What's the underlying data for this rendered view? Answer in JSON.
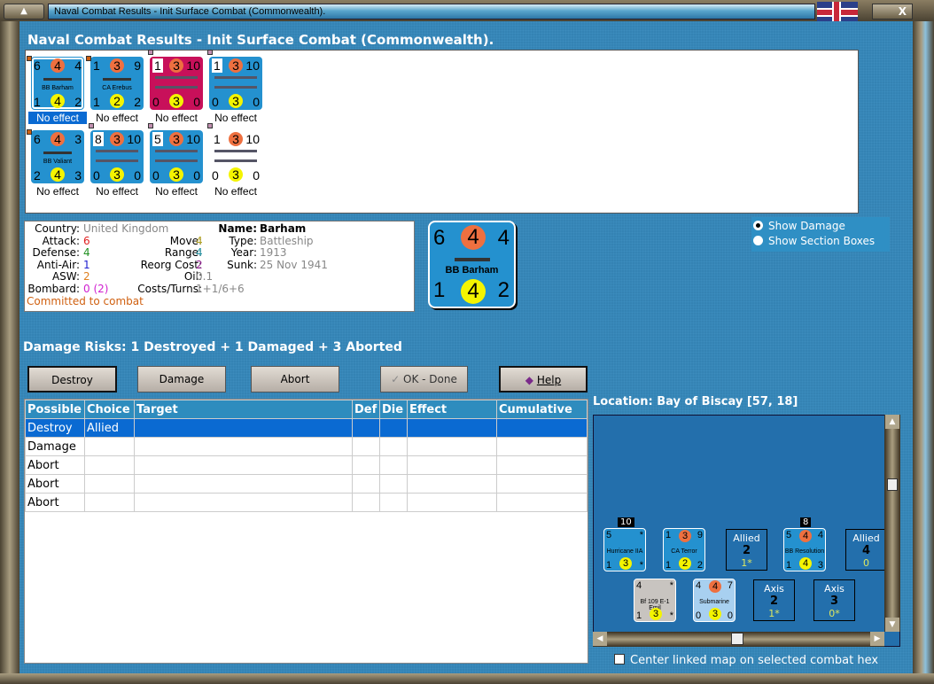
{
  "window": {
    "title": "Naval Combat Results - Init Surface Combat (Commonwealth).",
    "close_label": "X"
  },
  "heading": "Naval Combat Results - Init Surface Combat (Commonwealth).",
  "counters": [
    {
      "tl": "6",
      "tm": "4",
      "tr": "4",
      "bl": "1",
      "bm": "4",
      "br": "2",
      "name": "BB Barham",
      "result": "No effect",
      "bg": "#2491cf"
    },
    {
      "tl": "1",
      "tm": "3",
      "tr": "9",
      "bl": "1",
      "bm": "2",
      "br": "2",
      "name": "CA Erebus",
      "result": "No effect",
      "bg": "#2491cf"
    },
    {
      "tl": "1",
      "tm": "3",
      "tr": "10",
      "bl": "0",
      "bm": "3",
      "br": "0",
      "name": "",
      "result": "No effect",
      "bg": "#c8105a"
    },
    {
      "tl": "1",
      "tm": "3",
      "tr": "10",
      "bl": "0",
      "bm": "3",
      "br": "0",
      "name": "",
      "result": "No effect",
      "bg": "#2491cf"
    },
    {
      "tl": "6",
      "tm": "4",
      "tr": "3",
      "bl": "2",
      "bm": "4",
      "br": "3",
      "name": "BB Valiant",
      "result": "No effect",
      "bg": "#2491cf"
    },
    {
      "tl": "8",
      "tm": "3",
      "tr": "10",
      "bl": "0",
      "bm": "3",
      "br": "0",
      "name": "",
      "result": "No effect",
      "bg": "#2491cf"
    },
    {
      "tl": "5",
      "tm": "3",
      "tr": "10",
      "bl": "0",
      "bm": "3",
      "br": "0",
      "name": "",
      "result": "No effect",
      "bg": "#2491cf"
    },
    {
      "tl": "1",
      "tm": "3",
      "tr": "10",
      "bl": "0",
      "bm": "3",
      "br": "0",
      "name": "",
      "result": "No effect",
      "bg": "#ffffff"
    }
  ],
  "info": {
    "country_label": "Country:",
    "country": "United Kingdom",
    "attack_label": "Attack:",
    "attack": "6",
    "defense_label": "Defense:",
    "defense": "4",
    "antiair_label": "Anti-Air:",
    "antiair": "1",
    "asw_label": "ASW:",
    "asw": "2",
    "bombard_label": "Bombard:",
    "bombard": "0 (2)",
    "move_label": "Move:",
    "move": "4",
    "range_label": "Range:",
    "range": "4",
    "reorg_label": "Reorg Cost:",
    "reorg": "2",
    "oil_label": "Oil:",
    "oil": "0.1",
    "costs_label": "Costs/Turns:",
    "costs": "1+1/6+6",
    "name_label": "Name:",
    "name": "Barham",
    "type_label": "Type:",
    "type": "Battleship",
    "year_label": "Year:",
    "year": "1913",
    "sunk_label": "Sunk:",
    "sunk": "25 Nov 1941",
    "status": "Committed to combat"
  },
  "big_counter": {
    "tl": "6",
    "tm": "4",
    "tr": "4",
    "bl": "1",
    "bm": "4",
    "br": "2",
    "name": "BB Barham"
  },
  "radios": {
    "show_damage": "Show Damage",
    "show_sections": "Show Section Boxes"
  },
  "damage_risks": "Damage Risks: 1 Destroyed + 1 Damaged + 3 Aborted",
  "buttons": {
    "destroy": "Destroy",
    "damage": "Damage",
    "abort": "Abort",
    "ok": "OK - Done",
    "help": "Help"
  },
  "table": {
    "headers": [
      "Possible",
      "Choice",
      "Target",
      "Def",
      "Die",
      "Effect",
      "Cumulative"
    ],
    "rows": [
      [
        "Destroy",
        "Allied"
      ],
      [
        "Damage",
        ""
      ],
      [
        "Abort",
        ""
      ],
      [
        "Abort",
        ""
      ],
      [
        "Abort",
        ""
      ]
    ]
  },
  "location": "Location:  Bay of Biscay [57, 18]",
  "map": {
    "stack1": "10",
    "stack2": "8",
    "units": [
      {
        "tl": "5",
        "tr": "*",
        "bl": "1",
        "bm": "3",
        "br": "*",
        "name": "Hurricane IIA"
      },
      {
        "tl": "1",
        "tm": "3",
        "tr": "9",
        "bl": "1",
        "bm": "2",
        "br": "2",
        "name": "CA Terror"
      },
      {
        "tl": "5",
        "tm": "4",
        "tr": "4",
        "bl": "1",
        "bm": "4",
        "br": "3",
        "name": "BB Resolution"
      },
      {
        "tl": "4",
        "tr": "*",
        "bl": "1",
        "bm": "3",
        "br": "*",
        "name": "Bf 109 E-1 Emil"
      },
      {
        "tl": "4",
        "tm": "4",
        "tr": "7",
        "bl": "0",
        "bm": "3",
        "br": "0",
        "name": "Submarine"
      }
    ],
    "summaries": [
      {
        "side": "Allied",
        "a": "2",
        "b": "1*"
      },
      {
        "side": "Allied",
        "a": "4",
        "b": "0"
      },
      {
        "side": "Axis",
        "a": "2",
        "b": "1*"
      },
      {
        "side": "Axis",
        "a": "3",
        "b": "0*"
      }
    ]
  },
  "center_checkbox": "Center linked map on selected combat hex"
}
